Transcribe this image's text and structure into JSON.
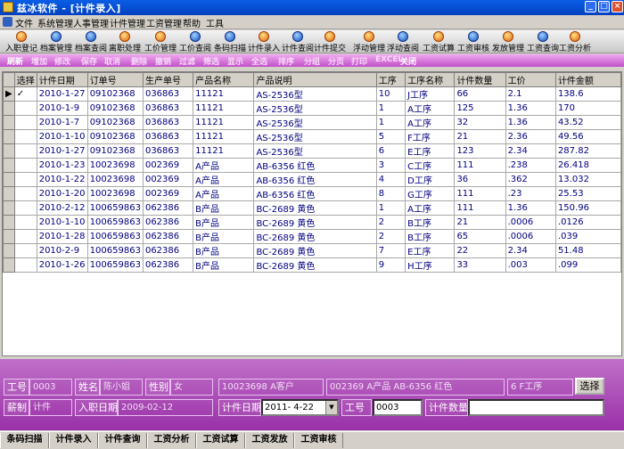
{
  "window": {
    "title": "兹冰软件 - [计件录入]"
  },
  "menu": [
    "文件",
    "系统管理",
    "人事管理",
    "计件管理",
    "工资管理",
    "帮助",
    "工具"
  ],
  "toolbar": [
    "入职登记",
    "档案管理",
    "档案查阅",
    "离职处理",
    "工价管理",
    "工价查阅",
    "条码扫描",
    "计件录入",
    "计件查阅",
    "计件提交",
    "浮动管理",
    "浮动查阅",
    "工资试算",
    "工资审核",
    "发放管理",
    "工资查询",
    "工资分析"
  ],
  "actions": [
    "刷新",
    "增加",
    "修改",
    "保存",
    "取消",
    "删除",
    "撤销",
    "过滤",
    "筛选",
    "显示",
    "全选",
    "排序",
    "分组",
    "分页",
    "打印",
    "EXCEL",
    "关闭"
  ],
  "grid": {
    "columns": [
      "选择",
      "计件日期",
      "订单号",
      "生产单号",
      "产品名称",
      "产品说明",
      "工序",
      "工序名称",
      "计件数量",
      "工价",
      "计件金额"
    ],
    "rows": [
      [
        "✓",
        "2010-1-27",
        "09102368",
        "036863",
        "11121",
        "AS-2536型",
        "10",
        "J工序",
        "66",
        "2.1",
        "138.6"
      ],
      [
        "",
        "2010-1-9",
        "09102368",
        "036863",
        "11121",
        "AS-2536型",
        "1",
        "A工序",
        "125",
        "1.36",
        "170"
      ],
      [
        "",
        "2010-1-7",
        "09102368",
        "036863",
        "11121",
        "AS-2536型",
        "1",
        "A工序",
        "32",
        "1.36",
        "43.52"
      ],
      [
        "",
        "2010-1-10",
        "09102368",
        "036863",
        "11121",
        "AS-2536型",
        "5",
        "F工序",
        "21",
        "2.36",
        "49.56"
      ],
      [
        "",
        "2010-1-27",
        "09102368",
        "036863",
        "11121",
        "AS-2536型",
        "6",
        "E工序",
        "123",
        "2.34",
        "287.82"
      ],
      [
        "",
        "2010-1-23",
        "10023698",
        "002369",
        "A产品",
        "AB-6356 红色",
        "3",
        "C工序",
        "111",
        ".238",
        "26.418"
      ],
      [
        "",
        "2010-1-22",
        "10023698",
        "002369",
        "A产品",
        "AB-6356 红色",
        "4",
        "D工序",
        "36",
        ".362",
        "13.032"
      ],
      [
        "",
        "2010-1-20",
        "10023698",
        "002369",
        "A产品",
        "AB-6356 红色",
        "8",
        "G工序",
        "111",
        ".23",
        "25.53"
      ],
      [
        "",
        "2010-2-12",
        "100659863",
        "062386",
        "B产品",
        "BC-2689 黄色",
        "1",
        "A工序",
        "111",
        "1.36",
        "150.96"
      ],
      [
        "",
        "2010-1-10",
        "100659863",
        "062386",
        "B产品",
        "BC-2689 黄色",
        "2",
        "B工序",
        "21",
        ".0006",
        ".0126"
      ],
      [
        "",
        "2010-1-28",
        "100659863",
        "062386",
        "B产品",
        "BC-2689 黄色",
        "2",
        "B工序",
        "65",
        ".0006",
        ".039"
      ],
      [
        "",
        "2010-2-9",
        "100659863",
        "062386",
        "B产品",
        "BC-2689 黄色",
        "7",
        "E工序",
        "22",
        "2.34",
        "51.48"
      ],
      [
        "",
        "2010-1-26",
        "100659863",
        "062386",
        "B产品",
        "BC-2689 黄色",
        "9",
        "H工序",
        "33",
        ".003",
        ".099"
      ]
    ]
  },
  "form": {
    "job_no_label": "工号",
    "job_no_value": "0003",
    "name_label": "姓名",
    "name_value": "陈小姐",
    "gender_label": "性别",
    "gender_value": "女",
    "order_info": "10023698  A客户",
    "product_info": "002369 A产品 AB-6356 红色",
    "process_info": "6 F工序",
    "select_button": "选择",
    "pay_type_label": "薪制",
    "pay_type_value": "计件",
    "hire_date_label": "入职日期",
    "hire_date_value": "2009-02-12",
    "piece_date_label": "计件日期",
    "piece_date_value": "2011- 4-22",
    "process_no_label": "工号",
    "process_no_value": "0003",
    "quantity_label": "计件数量",
    "quantity_value": ""
  },
  "tabs": [
    "条码扫描",
    "计件录入",
    "计件查询",
    "工资分析",
    "工资试算",
    "工资发放",
    "工资审核"
  ]
}
